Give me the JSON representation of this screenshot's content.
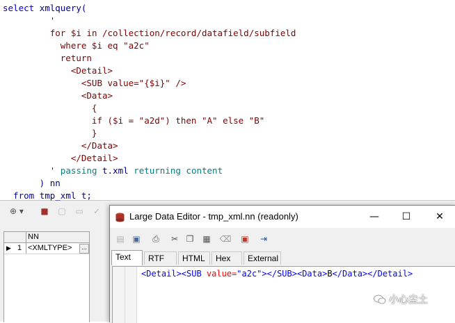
{
  "sql_editor": {
    "lines": [
      {
        "segments": [
          {
            "t": "select ",
            "c": "kw"
          },
          {
            "t": "xmlquery(",
            "c": "nm"
          }
        ]
      },
      {
        "segments": [
          {
            "t": "         '",
            "c": "st"
          }
        ]
      },
      {
        "segments": [
          {
            "t": "         ",
            "c": "st"
          },
          {
            "t": "for $i in /collection/record/datafield/subfield",
            "c": "st"
          }
        ]
      },
      {
        "segments": [
          {
            "t": "           where $i eq \"a2c\"",
            "c": "st"
          }
        ]
      },
      {
        "segments": [
          {
            "t": "           return",
            "c": "st"
          }
        ]
      },
      {
        "segments": [
          {
            "t": "             <Detail>",
            "c": "st"
          }
        ]
      },
      {
        "segments": [
          {
            "t": "               <SUB value=\"{$i}\" />",
            "c": "st"
          }
        ]
      },
      {
        "segments": [
          {
            "t": "               <Data>",
            "c": "st"
          }
        ]
      },
      {
        "segments": [
          {
            "t": "                 {",
            "c": "st"
          }
        ]
      },
      {
        "segments": [
          {
            "t": "                 if ($i = \"a2d\") then \"A\" else \"B\"",
            "c": "st"
          }
        ]
      },
      {
        "segments": [
          {
            "t": "                 }",
            "c": "st"
          }
        ]
      },
      {
        "segments": [
          {
            "t": "               </Data>",
            "c": "st"
          }
        ]
      },
      {
        "segments": [
          {
            "t": "             </Detail>",
            "c": "st"
          }
        ]
      },
      {
        "segments": [
          {
            "t": "         ' ",
            "c": "st"
          },
          {
            "t": "passing ",
            "c": "tg"
          },
          {
            "t": "t.xml ",
            "c": "nm"
          },
          {
            "t": "returning content",
            "c": "tg"
          }
        ]
      },
      {
        "segments": [
          {
            "t": "       ) nn",
            "c": "nm"
          }
        ]
      },
      {
        "segments": [
          {
            "t": "  from ",
            "c": "kw"
          },
          {
            "t": "tmp_xml t;",
            "c": "nm"
          }
        ]
      }
    ]
  },
  "result_grid": {
    "column_header": "NN",
    "rows": [
      {
        "row_number": "1",
        "value": "<XMLTYPE>",
        "ellipsis": "..."
      }
    ]
  },
  "data_editor": {
    "title": "Large Data Editor - tmp_xml.nn (readonly)",
    "window_buttons": {
      "minimize": "—",
      "maximize": "☐",
      "close": "✕"
    },
    "tabs": [
      "Text",
      "RTF",
      "HTML",
      "Hex",
      "External"
    ],
    "active_tab": "Text",
    "content": {
      "segments": [
        {
          "t": "<Detail>",
          "c": "tag"
        },
        {
          "t": "<SUB ",
          "c": "tag"
        },
        {
          "t": "value=",
          "c": "attr"
        },
        {
          "t": "\"a2c\"",
          "c": "val"
        },
        {
          "t": "></SUB>",
          "c": "tag"
        },
        {
          "t": "<Data>",
          "c": "tag"
        },
        {
          "t": "B",
          "c": "text"
        },
        {
          "t": "</Data>",
          "c": "tag"
        },
        {
          "t": "</Detail>",
          "c": "tag"
        }
      ]
    }
  },
  "watermark": {
    "text": "小心尘土"
  },
  "colors": {
    "keyword": "#0000c8",
    "identifier": "#000080",
    "string": "#800000",
    "sql_keyword_teal": "#008080",
    "xml_tag": "#0000ff",
    "xml_attr": "#ff0000",
    "xml_value": "#0000ff",
    "text": "#000000"
  }
}
